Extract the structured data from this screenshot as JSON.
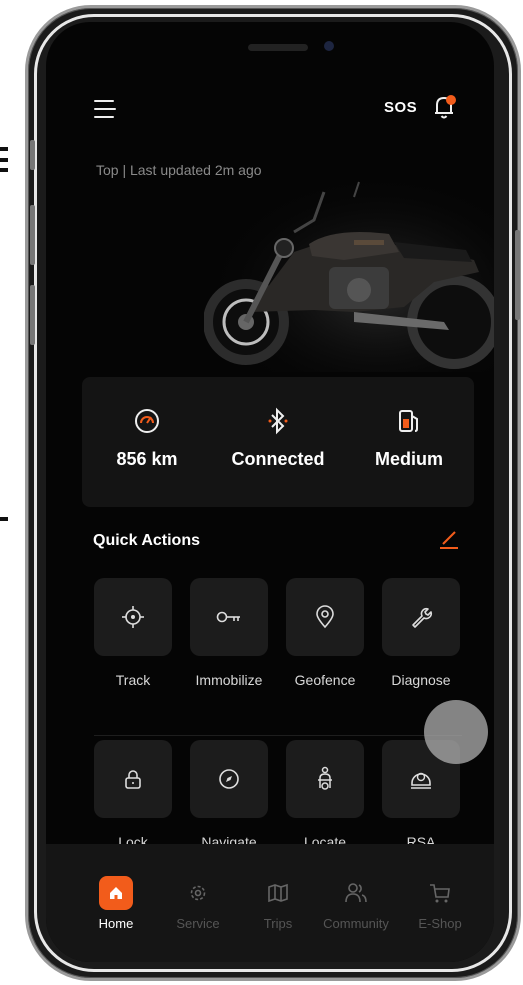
{
  "header": {
    "sos_label": "SOS"
  },
  "vehicle": {
    "status_text": "Top | Last updated 2m ago"
  },
  "stats": [
    {
      "icon": "speedometer-icon",
      "value": "856 km"
    },
    {
      "icon": "bluetooth-icon",
      "value": "Connected"
    },
    {
      "icon": "fuel-icon",
      "value": "Medium"
    }
  ],
  "quick_actions": {
    "title": "Quick Actions",
    "items": [
      {
        "icon": "crosshair-icon",
        "label": "Track"
      },
      {
        "icon": "key-icon",
        "label": "Immobilize"
      },
      {
        "icon": "location-pin-icon",
        "label": "Geofence"
      },
      {
        "icon": "wrench-icon",
        "label": "Diagnose"
      },
      {
        "icon": "padlock-icon",
        "label": "Lock"
      },
      {
        "icon": "compass-icon",
        "label": "Navigate"
      },
      {
        "icon": "scooter-icon",
        "label": "Locate"
      },
      {
        "icon": "helmet-icon",
        "label": "RSA"
      }
    ]
  },
  "tabs": [
    {
      "icon": "home-icon",
      "label": "Home"
    },
    {
      "icon": "service-gear-icon",
      "label": "Service"
    },
    {
      "icon": "map-icon",
      "label": "Trips"
    },
    {
      "icon": "community-icon",
      "label": "Community"
    },
    {
      "icon": "cart-icon",
      "label": "E-Shop"
    }
  ],
  "colors": {
    "accent": "#f25c1b",
    "background": "#050505",
    "card": "#141414",
    "tile": "#1c1c1c"
  }
}
